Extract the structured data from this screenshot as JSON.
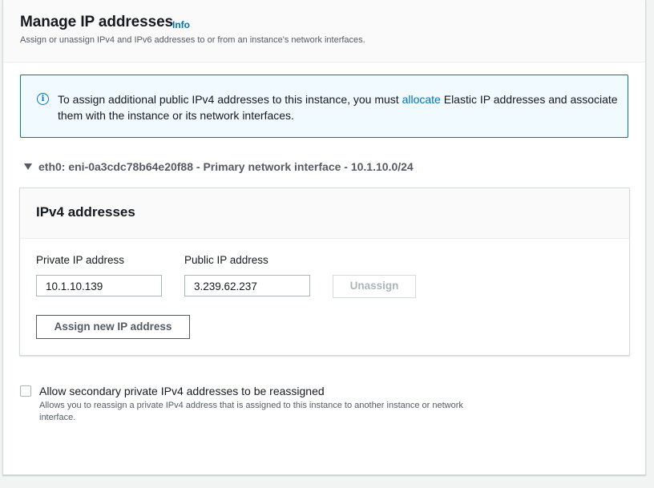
{
  "header": {
    "title": "Manage IP addresses",
    "info_link": "Info",
    "subtitle": "Assign or unassign IPv4 and IPv6 addresses to or from an instance's network interfaces."
  },
  "alert": {
    "icon": "info-circle-icon",
    "text_before": "To assign additional public IPv4 addresses to this instance, you must ",
    "link_text": "allocate",
    "text_after": " Elastic IP addresses and associate them with the instance or its network interfaces."
  },
  "interface": {
    "caret_icon": "caret-down-icon",
    "label": "eth0: eni-0a3cdc78b64e20f88 - Primary network interface - 10.1.10.0/24"
  },
  "ipv4": {
    "title": "IPv4 addresses",
    "private_label": "Private IP address",
    "public_label": "Public IP address",
    "private_value": "10.1.10.139",
    "public_value": "3.239.62.237",
    "unassign_button": "Unassign",
    "assign_button": "Assign new IP address"
  },
  "reassign": {
    "checked": false,
    "label": "Allow secondary private IPv4 addresses to be reassigned",
    "description": "Allows you to reassign a private IPv4 address that is assigned to this instance to another instance or network interface."
  },
  "colors": {
    "link": "#0073bb",
    "alert_background": "#f1faff",
    "header_background": "#fafafa",
    "disabled_text": "#aab7b8"
  }
}
